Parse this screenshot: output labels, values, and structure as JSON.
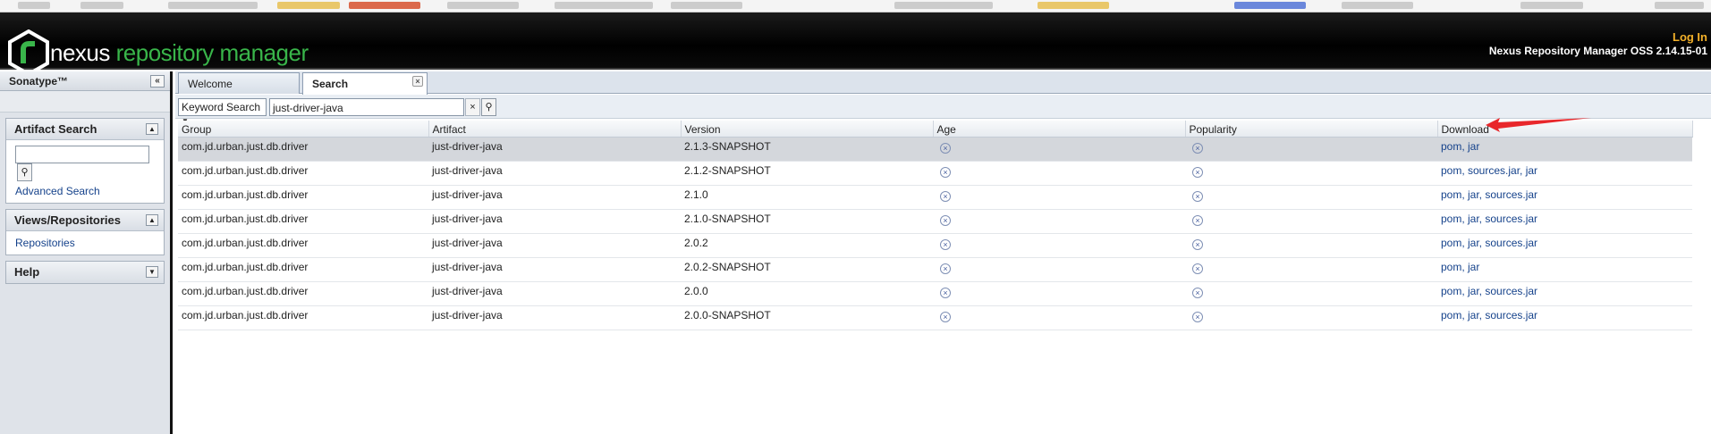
{
  "brand": {
    "part1": "nexus",
    "part2": " repository manager"
  },
  "header": {
    "login": "Log In",
    "version": "Nexus Repository Manager OSS 2.14.15-01"
  },
  "left": {
    "title": "Sonatype™",
    "collapse_icon": "«",
    "panels": [
      {
        "title": "Artifact Search",
        "link": "Advanced Search"
      },
      {
        "title": "Views/Repositories",
        "link": "Repositories"
      },
      {
        "title": "Help"
      }
    ]
  },
  "tabs": [
    {
      "label": "Welcome"
    },
    {
      "label": "Search"
    }
  ],
  "search": {
    "mode": "Keyword Search",
    "value": "just-driver-java"
  },
  "columns": [
    "Group",
    "Artifact",
    "Version",
    "Age",
    "Popularity",
    "Download"
  ],
  "rows": [
    {
      "group": "com.jd.urban.just.db.driver",
      "artifact": "just-driver-java",
      "version": "2.1.3-SNAPSHOT",
      "download": "pom, jar"
    },
    {
      "group": "com.jd.urban.just.db.driver",
      "artifact": "just-driver-java",
      "version": "2.1.2-SNAPSHOT",
      "download": "pom, sources.jar, jar"
    },
    {
      "group": "com.jd.urban.just.db.driver",
      "artifact": "just-driver-java",
      "version": "2.1.0",
      "download": "pom, jar, sources.jar"
    },
    {
      "group": "com.jd.urban.just.db.driver",
      "artifact": "just-driver-java",
      "version": "2.1.0-SNAPSHOT",
      "download": "pom, jar, sources.jar"
    },
    {
      "group": "com.jd.urban.just.db.driver",
      "artifact": "just-driver-java",
      "version": "2.0.2",
      "download": "pom, jar, sources.jar"
    },
    {
      "group": "com.jd.urban.just.db.driver",
      "artifact": "just-driver-java",
      "version": "2.0.2-SNAPSHOT",
      "download": "pom, jar"
    },
    {
      "group": "com.jd.urban.just.db.driver",
      "artifact": "just-driver-java",
      "version": "2.0.0",
      "download": "pom, jar, sources.jar"
    },
    {
      "group": "com.jd.urban.just.db.driver",
      "artifact": "just-driver-java",
      "version": "2.0.0-SNAPSHOT",
      "download": "pom, jar, sources.jar"
    }
  ],
  "icons": {
    "status": "circle-x-icon",
    "arrow": "red-arrow-icon"
  },
  "colors": {
    "accent": "#39b54a",
    "login": "#f3b12a",
    "link": "#15428b",
    "arrow": "#e8272b"
  }
}
